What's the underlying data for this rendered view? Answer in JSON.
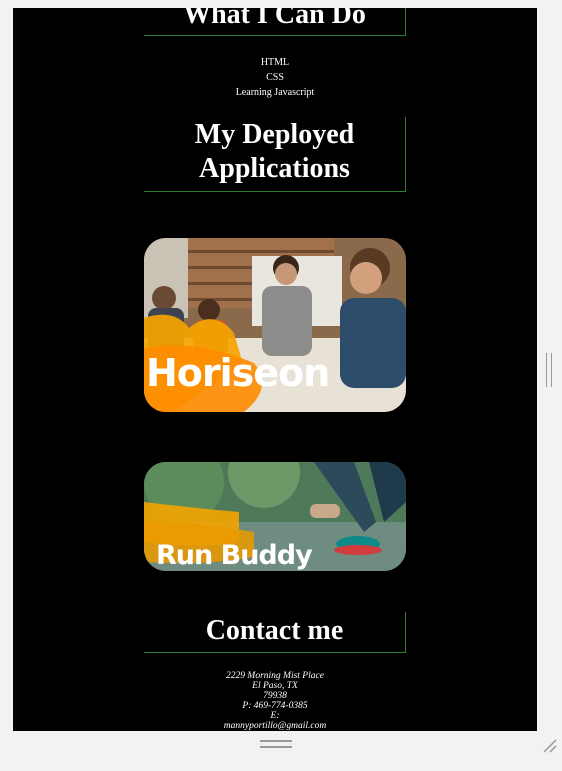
{
  "skills_section": {
    "title": "What I Can Do",
    "items": [
      "HTML",
      "CSS",
      "Learning Javascript"
    ]
  },
  "apps_section": {
    "title_line1": "My Deployed",
    "title_line2": "Applications",
    "apps": [
      {
        "name": "Horiseon"
      },
      {
        "name": "Run Buddy"
      }
    ]
  },
  "contact_section": {
    "title": "Contact me",
    "address_line1": "2229 Morning Mist Place",
    "address_line2": "El Paso, TX",
    "zip": "79938",
    "phone": "P: 469-774-0385",
    "email_label": "E:",
    "email": "mannyportillo@gmail.com"
  },
  "colors": {
    "page_bg": "#000000",
    "heading_border": "#2f7d2f",
    "text": "#ffffff",
    "chrome": "#f2f2f2"
  }
}
